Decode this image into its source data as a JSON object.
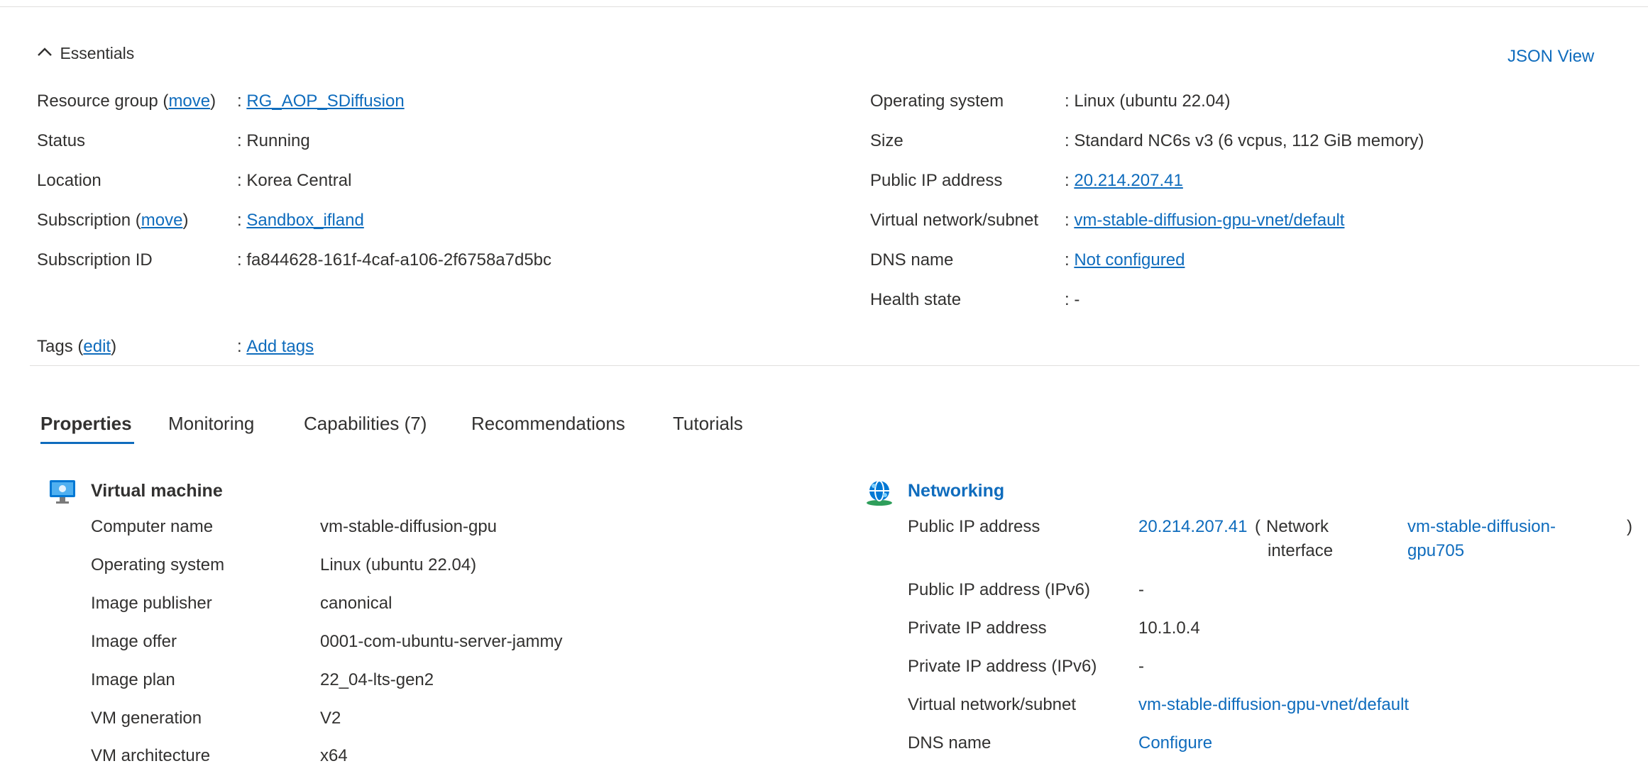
{
  "essentials": {
    "title": "Essentials",
    "json_view": "JSON View",
    "left": {
      "resource_group_label": "Resource group",
      "move_link": "move",
      "resource_group_value": "RG_AOP_SDiffusion",
      "status_label": "Status",
      "status_value": "Running",
      "location_label": "Location",
      "location_value": "Korea Central",
      "subscription_label": "Subscription",
      "subscription_value": "Sandbox_ifland",
      "subscription_id_label": "Subscription ID",
      "subscription_id_value": "fa844628-161f-4caf-a106-2f6758a7d5bc"
    },
    "right": {
      "os_label": "Operating system",
      "os_value": "Linux (ubuntu 22.04)",
      "size_label": "Size",
      "size_value": "Standard NC6s v3 (6 vcpus, 112 GiB memory)",
      "public_ip_label": "Public IP address",
      "public_ip_value": "20.214.207.41",
      "vnet_label": "Virtual network/subnet",
      "vnet_value": "vm-stable-diffusion-gpu-vnet/default",
      "dns_label": "DNS name",
      "dns_value": "Not configured",
      "health_label": "Health state",
      "health_value": "-"
    },
    "tags_label": "Tags",
    "tags_edit": "edit",
    "tags_value": "Add tags",
    "separator": ":"
  },
  "tabs": [
    {
      "label": "Properties",
      "active": true
    },
    {
      "label": "Monitoring"
    },
    {
      "label": "Capabilities (7)"
    },
    {
      "label": "Recommendations"
    },
    {
      "label": "Tutorials"
    }
  ],
  "vm_section": {
    "title": "Virtual machine",
    "icon": "monitor-icon",
    "rows": [
      {
        "label": "Computer name",
        "value": "vm-stable-diffusion-gpu"
      },
      {
        "label": "Operating system",
        "value": "Linux (ubuntu 22.04)"
      },
      {
        "label": "Image publisher",
        "value": "canonical"
      },
      {
        "label": "Image offer",
        "value": "0001-com-ubuntu-server-jammy"
      },
      {
        "label": "Image plan",
        "value": "22_04-lts-gen2"
      },
      {
        "label": "VM generation",
        "value": "V2"
      },
      {
        "label": "VM architecture",
        "value": "x64"
      }
    ]
  },
  "net_section": {
    "title": "Networking",
    "icon": "globe-network-icon",
    "public_ip_label": "Public IP address",
    "public_ip_value": "20.214.207.41",
    "paren_open": "(",
    "ni_label_1": "Network",
    "ni_label_2": "interface",
    "ni_value_1": "vm-stable-diffusion-",
    "ni_value_2": "gpu705",
    "paren_close": ")",
    "rows": [
      {
        "label": "Public IP address (IPv6)",
        "value": "-"
      },
      {
        "label": "Private IP address",
        "value": "10.1.0.4"
      },
      {
        "label": "Private IP address (IPv6)",
        "value": "-"
      },
      {
        "label": "Virtual network/subnet",
        "value": "vm-stable-diffusion-gpu-vnet/default"
      },
      {
        "label": "DNS name",
        "value": "Configure"
      }
    ]
  },
  "colors": {
    "link": "#0f6cbd",
    "text": "#323130",
    "divider": "#e1dfdd"
  }
}
